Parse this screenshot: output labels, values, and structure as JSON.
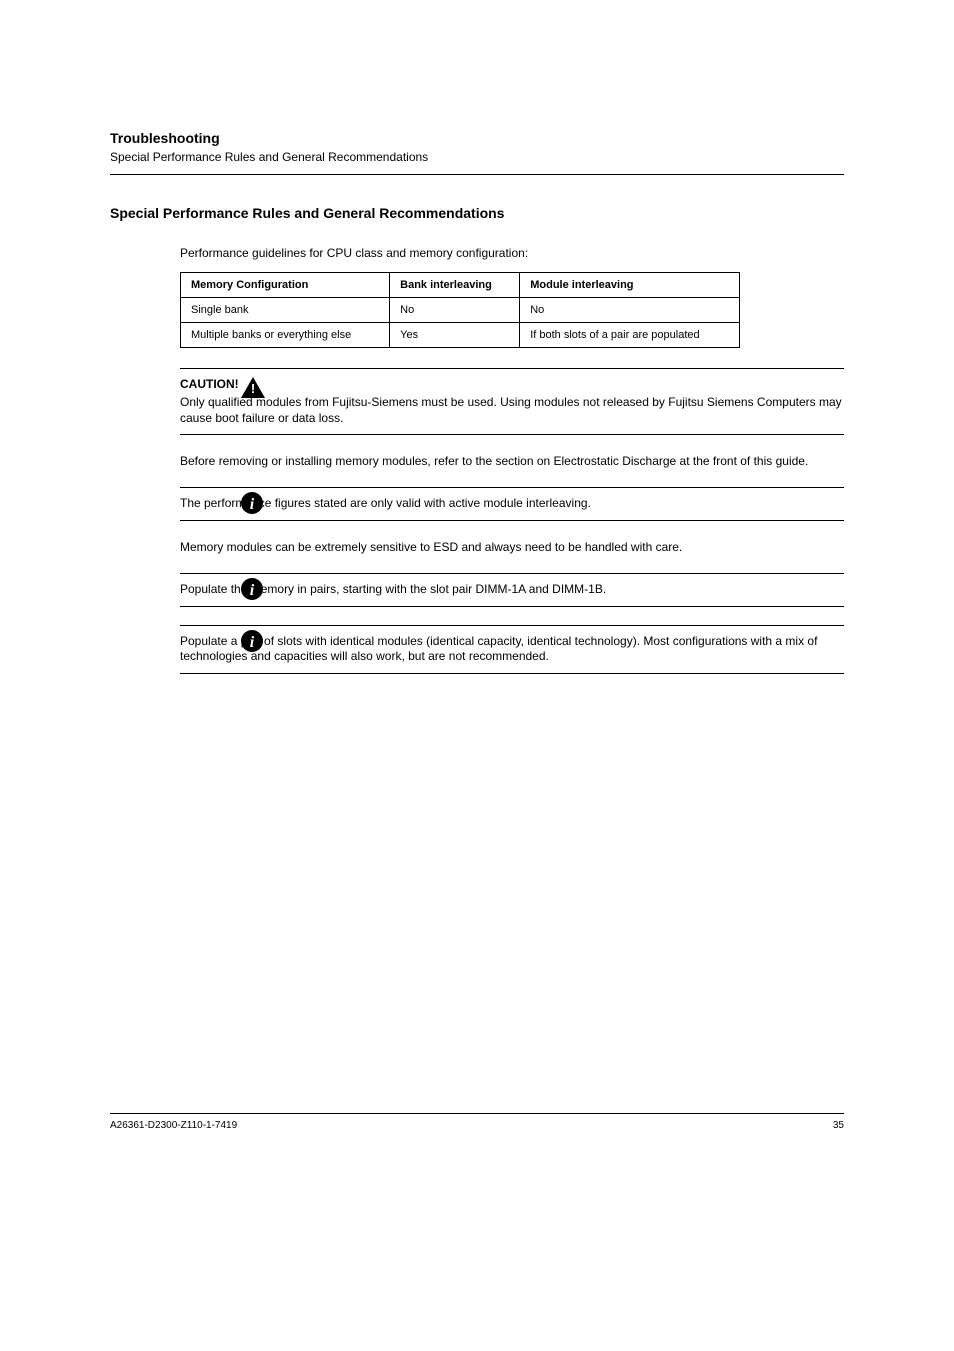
{
  "header": {
    "title": "Troubleshooting",
    "sub": "Special Performance Rules and General Recommendations"
  },
  "section_heading": "Special Performance Rules and General Recommendations",
  "intro": "Performance guidelines for CPU class and memory configuration:",
  "table": {
    "headers": [
      "Memory Configuration",
      "Bank interleaving",
      "Module interleaving"
    ],
    "rows": [
      [
        "Single bank",
        "No",
        "No"
      ],
      [
        "Multiple banks or everything else",
        "Yes",
        "If both slots of a pair are populated"
      ]
    ]
  },
  "notes": [
    {
      "icon": "caution",
      "title": "CAUTION!",
      "body": "Only qualified modules from Fujitsu-Siemens must be used. Using modules not released by Fujitsu Siemens Computers may cause boot failure or data loss."
    },
    {
      "icon": "info",
      "body": "The performance figures stated are only valid with active module interleaving."
    },
    {
      "icon": "info",
      "body": "Populate the memory in pairs, starting with the slot pair DIMM-1A and DIMM-1B."
    },
    {
      "icon": "info",
      "body": "Populate a pair of slots with identical modules (identical capacity, identical technology). Most configurations with a mix of technologies and capacities will also work, but are not recommended."
    }
  ],
  "paragraphs": [
    "Before removing or installing memory modules, refer to the section on Electrostatic Discharge at the front of this guide.",
    "Memory modules can be extremely sensitive to ESD and always need to be handled with care."
  ],
  "footer": {
    "left": "A26361-D2300-Z110-1-7419",
    "right": "35"
  }
}
